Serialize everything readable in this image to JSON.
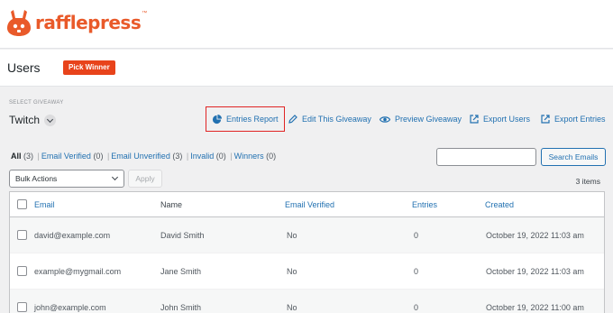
{
  "brand": {
    "name": "rafflepress",
    "tm": "™",
    "color": "#e95a2a"
  },
  "header": {
    "title": "Users",
    "pick_winner": "Pick Winner"
  },
  "giveaway": {
    "label": "SELECT GIVEAWAY",
    "value": "Twitch"
  },
  "actions": [
    {
      "label": "Entries Report",
      "icon": "pie-chart-icon",
      "highlighted": true
    },
    {
      "label": "Edit This Giveaway",
      "icon": "pencil-icon"
    },
    {
      "label": "Preview Giveaway",
      "icon": "eye-icon"
    },
    {
      "label": "Export Users",
      "icon": "export-icon"
    },
    {
      "label": "Export Entries",
      "icon": "export-icon"
    }
  ],
  "filters": [
    {
      "label": "All",
      "count": "(3)",
      "current": true
    },
    {
      "label": "Email Verified",
      "count": "(0)"
    },
    {
      "label": "Email Unverified",
      "count": "(3)"
    },
    {
      "label": "Invalid",
      "count": "(0)"
    },
    {
      "label": "Winners",
      "count": "(0)"
    }
  ],
  "search": {
    "button": "Search Emails",
    "placeholder": ""
  },
  "bulk": {
    "selected": "Bulk Actions",
    "apply": "Apply"
  },
  "items_count": "3 items",
  "table": {
    "columns": [
      "Email",
      "Name",
      "Email Verified",
      "Entries",
      "Created"
    ],
    "rows": [
      {
        "email": "david@example.com",
        "name": "David Smith",
        "verified": "No",
        "entries": "0",
        "created": "October 19, 2022 11:03 am"
      },
      {
        "email": "example@mygmail.com",
        "name": "Jane Smith",
        "verified": "No",
        "entries": "0",
        "created": "October 19, 2022 11:03 am"
      },
      {
        "email": "john@example.com",
        "name": "John Smith",
        "verified": "No",
        "entries": "0",
        "created": "October 19, 2022 11:00 am"
      }
    ]
  }
}
